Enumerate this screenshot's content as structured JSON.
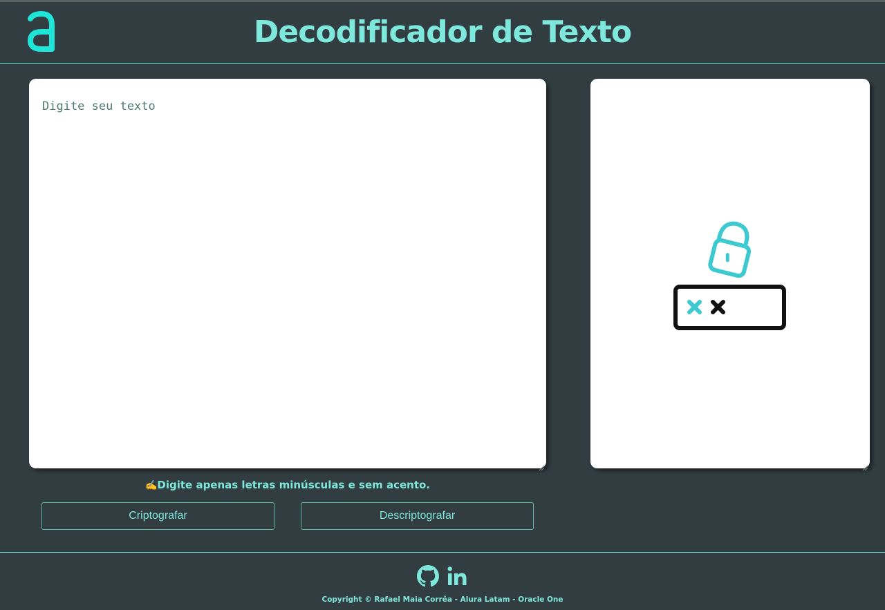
{
  "header": {
    "logo_icon": "alura-a-logo-icon",
    "title": "Decodificador de Texto"
  },
  "input": {
    "placeholder": "Digite seu texto",
    "value": ""
  },
  "output": {
    "illustration_icon": "unlocked-padlock-password-icon"
  },
  "hint": {
    "icon": "✍️",
    "text": "Digite apenas letras minúsculas e sem acento."
  },
  "buttons": {
    "encrypt_label": "Criptografar",
    "decrypt_label": "Descriptografar"
  },
  "footer": {
    "social": [
      {
        "icon": "github-icon"
      },
      {
        "icon": "linkedin-icon"
      }
    ],
    "copyright": "Copyright © Rafael Maia Corrêa - Alura Latam - Oracle One"
  },
  "colors": {
    "background": "#323d41",
    "accent": "#7ee8dc",
    "logo": "#1fe5d8",
    "illustration_teal": "#3cc9cf",
    "card": "#ffffff"
  }
}
